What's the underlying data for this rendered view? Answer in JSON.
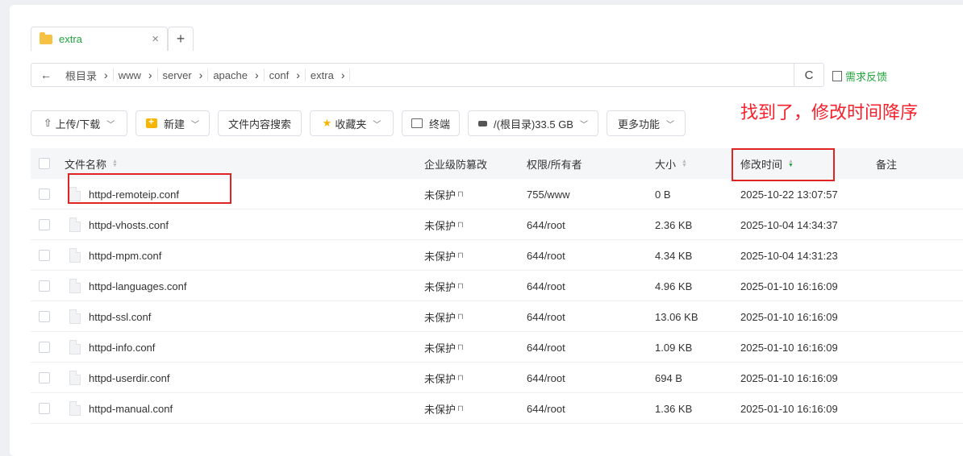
{
  "tab": {
    "label": "extra",
    "close": "×",
    "add": "+"
  },
  "address": {
    "back": "←",
    "crumbs": [
      "根目录",
      "www",
      "server",
      "apache",
      "conf",
      "extra"
    ],
    "sep": "›",
    "refresh": "C"
  },
  "feedback": "需求反馈",
  "toolbar": {
    "upload": "上传/下载",
    "new": "新建",
    "search": "文件内容搜索",
    "favorites": "收藏夹",
    "terminal": "终端",
    "disk": "/(根目录)33.5 GB",
    "more": "更多功能"
  },
  "annotation": "找到了，修改时间降序",
  "table": {
    "headers": {
      "name": "文件名称",
      "protect": "企业级防篡改",
      "perm": "权限/所有者",
      "size": "大小",
      "mtime": "修改时间",
      "note": "备注"
    },
    "rows": [
      {
        "name": "httpd-remoteip.conf",
        "protect": "未保护",
        "perm": "755/www",
        "size": "0 B",
        "mtime": "2025-10-22 13:07:57"
      },
      {
        "name": "httpd-vhosts.conf",
        "protect": "未保护",
        "perm": "644/root",
        "size": "2.36 KB",
        "mtime": "2025-10-04 14:34:37"
      },
      {
        "name": "httpd-mpm.conf",
        "protect": "未保护",
        "perm": "644/root",
        "size": "4.34 KB",
        "mtime": "2025-10-04 14:31:23"
      },
      {
        "name": "httpd-languages.conf",
        "protect": "未保护",
        "perm": "644/root",
        "size": "4.96 KB",
        "mtime": "2025-01-10 16:16:09"
      },
      {
        "name": "httpd-ssl.conf",
        "protect": "未保护",
        "perm": "644/root",
        "size": "13.06 KB",
        "mtime": "2025-01-10 16:16:09"
      },
      {
        "name": "httpd-info.conf",
        "protect": "未保护",
        "perm": "644/root",
        "size": "1.09 KB",
        "mtime": "2025-01-10 16:16:09"
      },
      {
        "name": "httpd-userdir.conf",
        "protect": "未保护",
        "perm": "644/root",
        "size": "694 B",
        "mtime": "2025-01-10 16:16:09"
      },
      {
        "name": "httpd-manual.conf",
        "protect": "未保护",
        "perm": "644/root",
        "size": "1.36 KB",
        "mtime": "2025-01-10 16:16:09"
      }
    ]
  },
  "colors": {
    "accent": "#20a53a",
    "annotation": "#f5222d",
    "highlight_border": "#e02424"
  }
}
